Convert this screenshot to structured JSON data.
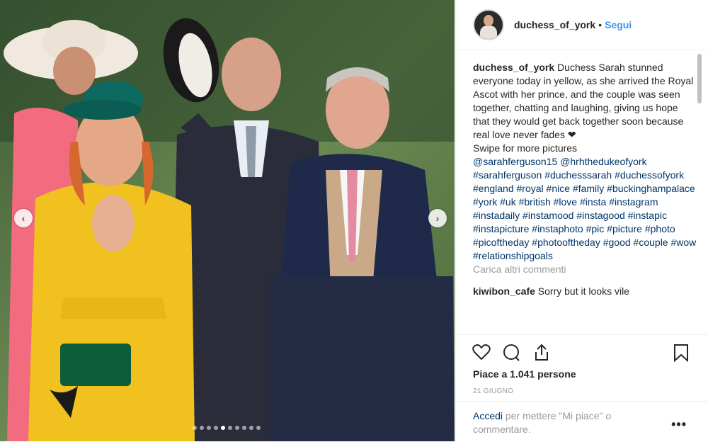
{
  "post": {
    "username": "duchess_of_york",
    "separator": "•",
    "follow_label": "Segui",
    "caption_user": "duchess_of_york",
    "caption_text": " Duchess Sarah stunned everyone today in yellow, as she arrived the Royal Ascot with her prince, and the couple was seen together, chatting and laughing, giving us hope that they would get back together soon because real love never fades ❤",
    "swipe_text": "Swipe for more pictures",
    "mentions": [
      "@sarahferguson15",
      "@hrhthedukeofyork"
    ],
    "hashtags": [
      "#sarahferguson",
      "#duchesssarah",
      "#duchessofyork",
      "#england",
      "#royal",
      "#nice",
      "#family",
      "#buckinghampalace",
      "#york",
      "#uk",
      "#british",
      "#love",
      "#insta",
      "#instagram",
      "#instadaily",
      "#instamood",
      "#instagood",
      "#instapic",
      "#instapicture",
      "#instaphoto",
      "#pic",
      "#picture",
      "#photo",
      "#picoftheday",
      "#photooftheday",
      "#good",
      "#couple",
      "#wow",
      "#relationshipgoals"
    ],
    "load_more": "Carica altri commenti",
    "next_comment": {
      "user": "kiwibon_cafe",
      "text": " Sorry but it looks vile"
    },
    "likes": "Piace a 1.041 persone",
    "date": "21 GIUGNO",
    "login_link": "Accedi",
    "login_text": " per mettere \"Mi piace\" o commentare.",
    "more_options": "•••"
  },
  "carousel": {
    "total": 10,
    "active_index": 4
  },
  "icons": {
    "like": "heart-icon",
    "comment": "comment-icon",
    "share": "share-icon",
    "save": "bookmark-icon",
    "prev": "chevron-left-icon",
    "next": "chevron-right-icon"
  },
  "colors": {
    "link": "#003569",
    "follow": "#3897f0",
    "text": "#262626",
    "muted": "#999999"
  }
}
